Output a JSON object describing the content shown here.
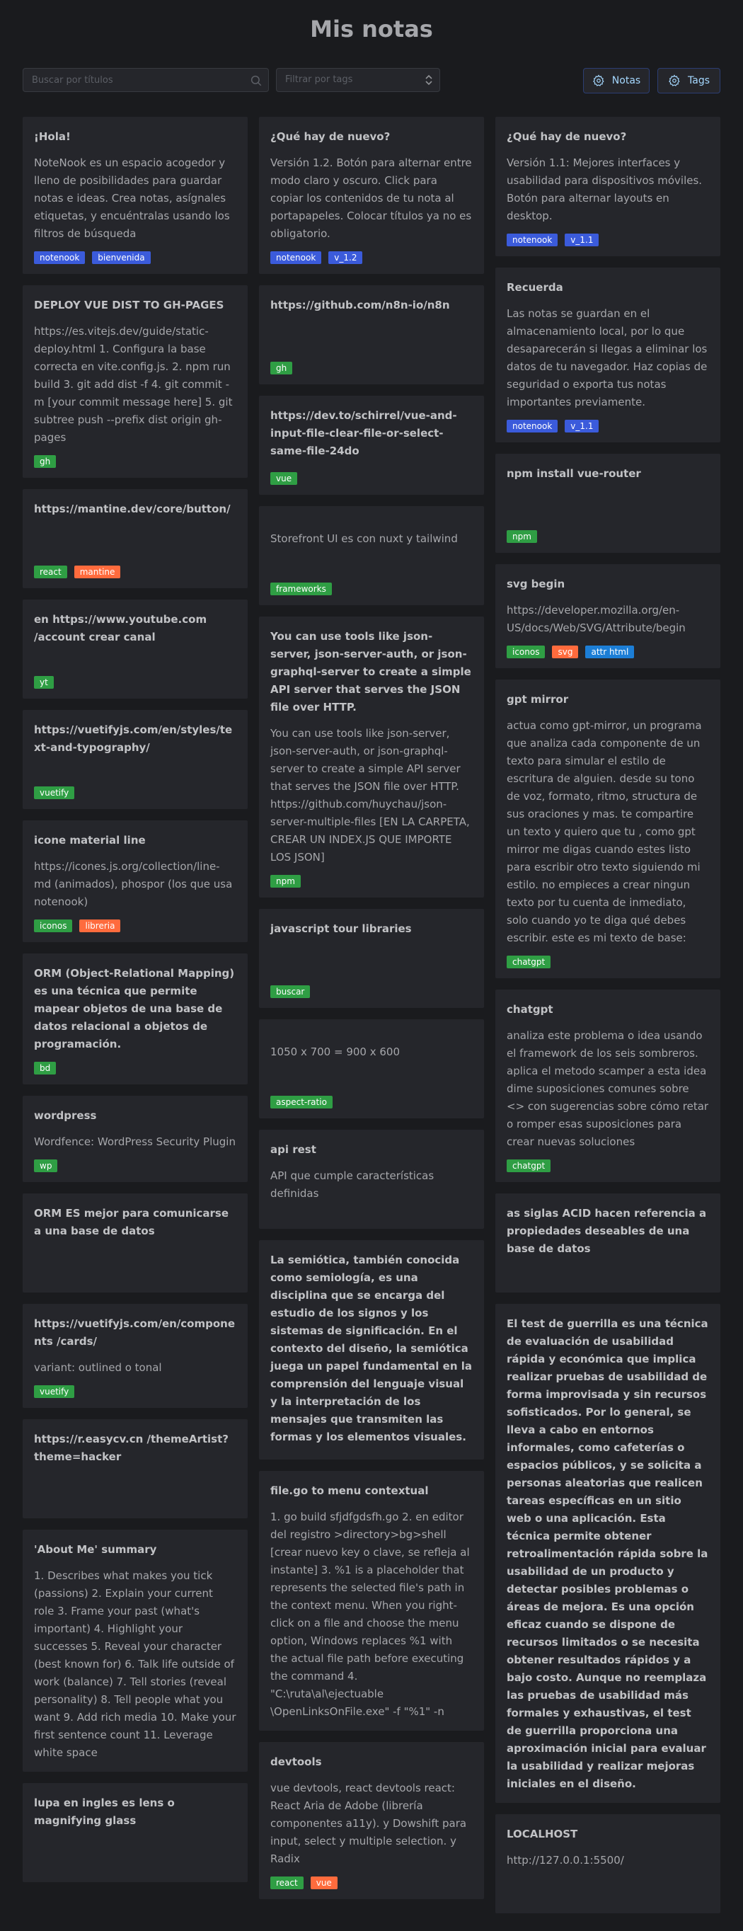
{
  "page": {
    "title": "Mis notas"
  },
  "toolbar": {
    "search_placeholder": "Buscar por títulos",
    "tags_placeholder": "Filtrar por tags",
    "notas_label": "Notas",
    "tags_label": "Tags"
  },
  "tag_colors": {
    "notenook": "#3b5bdb",
    "bienvenida": "#3b5bdb",
    "v_1.2": "#3b5bdb",
    "v_1.1": "#3b5bdb",
    "gh": "#2f9e44",
    "react": "#2f9e44",
    "yt": "#2f9e44",
    "vuetify": "#2f9e44",
    "iconos": "#2f9e44",
    "bd": "#2f9e44",
    "wp": "#2f9e44",
    "vue": "#2f9e44",
    "frameworks": "#2f9e44",
    "npm": "#2f9e44",
    "buscar": "#2f9e44",
    "aspect-ratio": "#2f9e44",
    "chatgpt": "#2f9e44",
    "mantine": "#ff6b3d",
    "libreria": "#ff6b3d",
    "svg": "#ff6b3d",
    "attr html": "#1c7ed6"
  },
  "tag_colors_override": {
    "react@devtools": "#2f9e44",
    "vue@devtools": "#ff6b3d"
  },
  "columns": [
    [
      {
        "title": "¡Hola!",
        "body": "NoteNook es un espacio acogedor y lleno de posibilidades para guardar notas e ideas. Crea notas, asígnales etiquetas, y encuéntralas usando los filtros de búsqueda",
        "tags": [
          "notenook",
          "bienvenida"
        ]
      },
      {
        "title": "DEPLOY VUE DIST TO GH-PAGES",
        "body": "https://es.vitejs.dev/guide/static-deploy.html 1. Configura la base correcta en vite.config.js. 2. npm run build 3. git add dist -f 4. git commit -m [your commit message here] 5. git subtree push --prefix dist origin gh-pages",
        "tags": [
          "gh"
        ]
      },
      {
        "title": "https://mantine.dev/core/button/",
        "body": "",
        "tags": [
          "react",
          "mantine"
        ],
        "minh": 140
      },
      {
        "title": "en https://www.youtube.com /account crear canal",
        "body": "",
        "tags": [
          "yt"
        ],
        "minh": 140
      },
      {
        "title": "https://vuetifyjs.com/en/styles/text-and-typography/",
        "body": "",
        "tags": [
          "vuetify"
        ],
        "minh": 140
      },
      {
        "title": "icone material line",
        "body": "https://icones.js.org/collection/line-md (animados), phospor (los que usa notenook)",
        "tags": [
          "iconos",
          "libreria"
        ]
      },
      {
        "title": "ORM (Object-Relational Mapping) es una técnica que permite mapear objetos de una base de datos relacional a objetos de programación.",
        "body": "",
        "tags": [
          "bd"
        ],
        "minh": 175
      },
      {
        "title": "wordpress",
        "body": "Wordfence: WordPress Security Plugin",
        "tags": [
          "wp"
        ]
      },
      {
        "title": "ORM ES mejor para comunicarse a una base de datos",
        "body": "",
        "tags": [],
        "minh": 140
      },
      {
        "title": "https://vuetifyjs.com/en/components /cards/",
        "body": "variant: outlined o tonal",
        "tags": [
          "vuetify"
        ]
      },
      {
        "title": "https://r.easycv.cn /themeArtist?theme=hacker",
        "body": "",
        "tags": [],
        "minh": 140
      },
      {
        "title": "'About Me' summary",
        "body": "1. Describes what makes you tick (passions) 2. Explain your current role 3. Frame your past (what's important) 4. Highlight your successes 5. Reveal your character (best known for) 6. Talk life outside of work (balance) 7. Tell stories (reveal personality) 8. Tell people what you want 9. Add rich media 10. Make your first sentence count 11. Leverage white space",
        "tags": []
      },
      {
        "title": "lupa en ingles es lens o magnifying glass",
        "body": "",
        "tags": [],
        "minh": 140
      }
    ],
    [
      {
        "title": "¿Qué hay de nuevo?",
        "body": "Versión 1.2. Botón para alternar entre modo claro y oscuro. Click para copiar los contenidos de tu nota al portapapeles. Colocar títulos ya no es obligatorio.",
        "tags": [
          "notenook",
          "v_1.2"
        ]
      },
      {
        "title": "https://github.com/n8n-io/n8n",
        "body": "",
        "tags": [
          "gh"
        ],
        "minh": 140
      },
      {
        "title": "https://dev.to/schirrel/vue-and-input-file-clear-file-or-select-same-file-24do",
        "body": "",
        "tags": [
          "vue"
        ],
        "minh": 140
      },
      {
        "title": "",
        "body": "Storefront UI es con nuxt y tailwind",
        "tags": [
          "frameworks"
        ],
        "minh": 140,
        "bodyTop": true
      },
      {
        "title": "You can use tools like json-server, json-server-auth, or json-graphql-server to create a simple API server that serves the JSON file over HTTP.",
        "body": "You can use tools like json-server, json-server-auth, or json-graphql-server to create a simple API server that serves the JSON file over HTTP. https://github.com/huychau/json-server-multiple-files [EN LA CARPETA, CREAR UN INDEX.JS QUE IMPORTE LOS JSON]",
        "tags": [
          "npm"
        ]
      },
      {
        "title": "javascript tour libraries",
        "body": "",
        "tags": [
          "buscar"
        ],
        "minh": 140
      },
      {
        "title": "",
        "body": "1050 x 700 = 900 x 600",
        "tags": [
          "aspect-ratio"
        ],
        "minh": 140,
        "bodyTop": true
      },
      {
        "title": "api rest",
        "body": "API que cumple características definidas",
        "tags": [],
        "minh": 140
      },
      {
        "title": "La semiótica, también conocida como semiología, es una disciplina que se encarga del estudio de los signos y los sistemas de significación. En el contexto del diseño, la semiótica juega un papel fundamental en la comprensión del lenguaje visual y la interpretación de los mensajes que transmiten las formas y los elementos visuales.",
        "body": "",
        "tags": [],
        "minh": 310
      },
      {
        "title": "file.go to menu contextual",
        "body": "1. go build sfjdfgdsfh.go 2. en editor del registro >directory>bg>shell [crear nuevo key o clave, se refleja al instante] 3. %1 is a placeholder that represents the selected file's path in the context menu. When you right-click on a file and choose the menu option, Windows replaces %1 with the actual file path before executing the command 4. \"C:\\ruta\\al\\ejectuable \\OpenLinksOnFile.exe\" -f \"%1\" -n",
        "tags": []
      },
      {
        "title": "devtools",
        "body": "vue devtools, react devtools react: React Aria de Adobe (librería componentes a11y). y Dowshift para input, select y multiple selection. y Radix",
        "tags": [
          "react",
          "vue"
        ],
        "tagkey": "devtools"
      }
    ],
    [
      {
        "title": "¿Qué hay de nuevo?",
        "body": "Versión 1.1: Mejores interfaces y usabilidad para dispositivos móviles. Botón para alternar layouts en desktop.",
        "tags": [
          "notenook",
          "v_1.1"
        ]
      },
      {
        "title": "Recuerda",
        "body": "Las notas se guardan en el almacenamiento local, por lo que desaparecerán si llegas a eliminar los datos de tu navegador. Haz copias de seguridad o exporta tus notas importantes previamente.",
        "tags": [
          "notenook",
          "v_1.1"
        ]
      },
      {
        "title": "npm install vue-router",
        "body": "",
        "tags": [
          "npm"
        ],
        "minh": 140
      },
      {
        "title": "svg begin",
        "body": "https://developer.mozilla.org/en-US/docs/Web/SVG/Attribute/begin",
        "tags": [
          "iconos",
          "svg",
          "attr html"
        ]
      },
      {
        "title": "gpt mirror",
        "body": "actua como gpt-mirror, un programa que analiza cada componente de un texto para simular el estilo de escritura de alguien. desde su tono de voz, formato, ritmo, structura de sus oraciones y mas. te compartire un texto y quiero que tu , como gpt mirror me digas cuando estes listo para escribir otro texto siguiendo mi estilo. no empieces a crear ningun texto por tu cuenta de inmediato, solo cuando yo te diga qué debes escribir. este es mi texto de base:",
        "tags": [
          "chatgpt"
        ]
      },
      {
        "title": "chatgpt",
        "body": "analiza este problema o idea usando el framework de los seis sombreros. aplica el metodo scamper a esta idea dime suposiciones comunes sobre <> con sugerencias sobre cómo retar o romper esas suposiciones para crear nuevas soluciones",
        "tags": [
          "chatgpt"
        ]
      },
      {
        "title": "as siglas ACID hacen referencia a propiedades deseables de una base de datos",
        "body": "",
        "tags": [],
        "minh": 140
      },
      {
        "title": "El test de guerrilla es una técnica de evaluación de usabilidad rápida y económica que implica realizar pruebas de usabilidad de forma improvisada y sin recursos sofisticados. Por lo general, se lleva a cabo en entornos informales, como cafeterías o espacios públicos, y se solicita a personas aleatorias que realicen tareas específicas en un sitio web o una aplicación. Esta técnica permite obtener retroalimentación rápida sobre la usabilidad de un producto y detectar posibles problemas o áreas de mejora. Es una opción eficaz cuando se dispone de recursos limitados o se necesita obtener resultados rápidos y a bajo costo. Aunque no reemplaza las pruebas de usabilidad más formales y exhaustivas, el test de guerrilla proporciona una aproximación inicial para evaluar la usabilidad y realizar mejoras iniciales en el diseño.",
        "body": "",
        "tags": [],
        "minh": 650
      },
      {
        "title": "LOCALHOST",
        "body": "http://127.0.0.1:5500/",
        "tags": [],
        "minh": 140
      }
    ]
  ]
}
